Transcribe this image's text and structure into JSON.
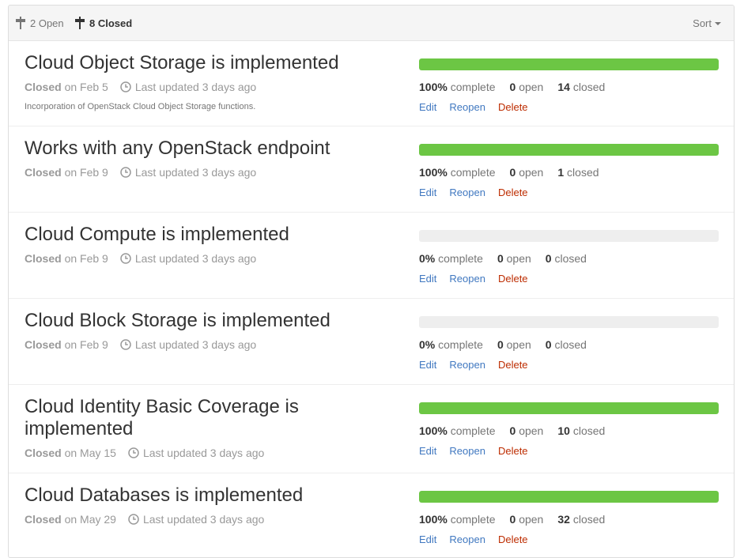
{
  "header": {
    "open_label": "2 Open",
    "closed_label": "8 Closed",
    "sort_label": "Sort"
  },
  "milestones": [
    {
      "title": "Cloud Object Storage is implemented",
      "state": "Closed",
      "date": "on Feb 5",
      "updated": "Last updated 3 days ago",
      "description": "Incorporation of OpenStack Cloud Object Storage functions.",
      "progress": 1.0,
      "percent": "100%",
      "complete_label": "complete",
      "open_count": "0",
      "open_label": "open",
      "closed_count": "14",
      "closed_label": "closed"
    },
    {
      "title": "Works with any OpenStack endpoint",
      "state": "Closed",
      "date": "on Feb 9",
      "updated": "Last updated 3 days ago",
      "description": "",
      "progress": 1.0,
      "percent": "100%",
      "complete_label": "complete",
      "open_count": "0",
      "open_label": "open",
      "closed_count": "1",
      "closed_label": "closed"
    },
    {
      "title": "Cloud Compute is implemented",
      "state": "Closed",
      "date": "on Feb 9",
      "updated": "Last updated 3 days ago",
      "description": "",
      "progress": 0.0,
      "percent": "0%",
      "complete_label": "complete",
      "open_count": "0",
      "open_label": "open",
      "closed_count": "0",
      "closed_label": "closed"
    },
    {
      "title": "Cloud Block Storage is implemented",
      "state": "Closed",
      "date": "on Feb 9",
      "updated": "Last updated 3 days ago",
      "description": "",
      "progress": 0.0,
      "percent": "0%",
      "complete_label": "complete",
      "open_count": "0",
      "open_label": "open",
      "closed_count": "0",
      "closed_label": "closed"
    },
    {
      "title": "Cloud Identity Basic Coverage is implemented",
      "state": "Closed",
      "date": "on May 15",
      "updated": "Last updated 3 days ago",
      "description": "",
      "progress": 1.0,
      "percent": "100%",
      "complete_label": "complete",
      "open_count": "0",
      "open_label": "open",
      "closed_count": "10",
      "closed_label": "closed"
    },
    {
      "title": "Cloud Databases is implemented",
      "state": "Closed",
      "date": "on May 29",
      "updated": "Last updated 3 days ago",
      "description": "",
      "progress": 1.0,
      "percent": "100%",
      "complete_label": "complete",
      "open_count": "0",
      "open_label": "open",
      "closed_count": "32",
      "closed_label": "closed"
    }
  ],
  "actions": {
    "edit": "Edit",
    "reopen": "Reopen",
    "delete": "Delete"
  },
  "colors": {
    "progress": "#6cc644",
    "link": "#4078c0",
    "danger": "#bd2c00"
  }
}
